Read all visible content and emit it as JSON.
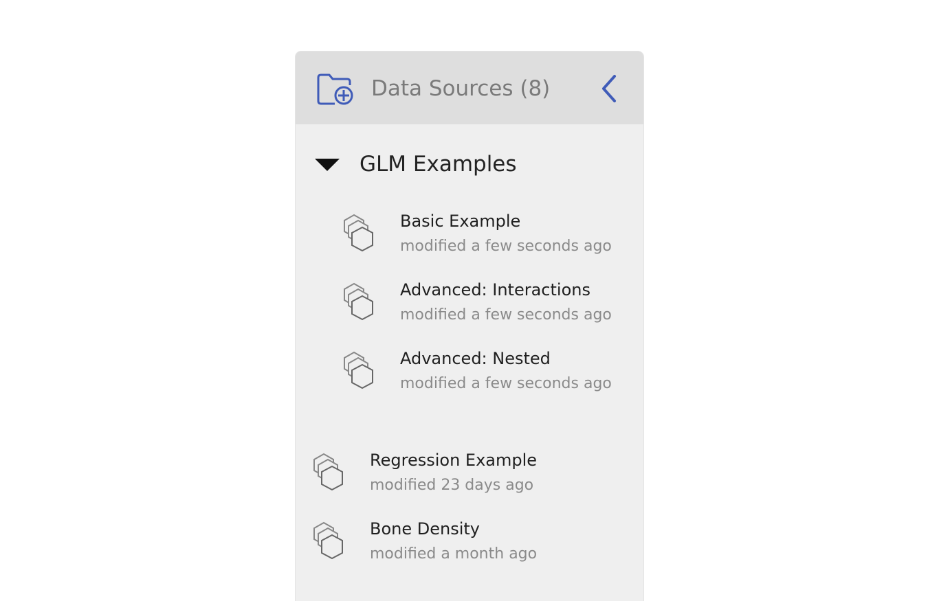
{
  "panel": {
    "title": "Data Sources (8)",
    "header_icon": "folder-add-icon",
    "collapse_icon": "chevron-left-icon",
    "accent_color": "#3f5bb8"
  },
  "group": {
    "title": "GLM Examples",
    "expanded": true,
    "items": [
      {
        "name": "Basic Example",
        "modified": "modified a few seconds ago",
        "icon": "dataset-stack-icon"
      },
      {
        "name": "Advanced: Interactions",
        "modified": "modified a few seconds ago",
        "icon": "dataset-stack-icon"
      },
      {
        "name": "Advanced: Nested",
        "modified": "modified a few seconds ago",
        "icon": "dataset-stack-icon"
      }
    ]
  },
  "items": [
    {
      "name": "Regression Example",
      "modified": "modified 23 days ago",
      "icon": "dataset-stack-icon"
    },
    {
      "name": "Bone Density",
      "modified": "modified a month ago",
      "icon": "dataset-stack-icon"
    }
  ]
}
